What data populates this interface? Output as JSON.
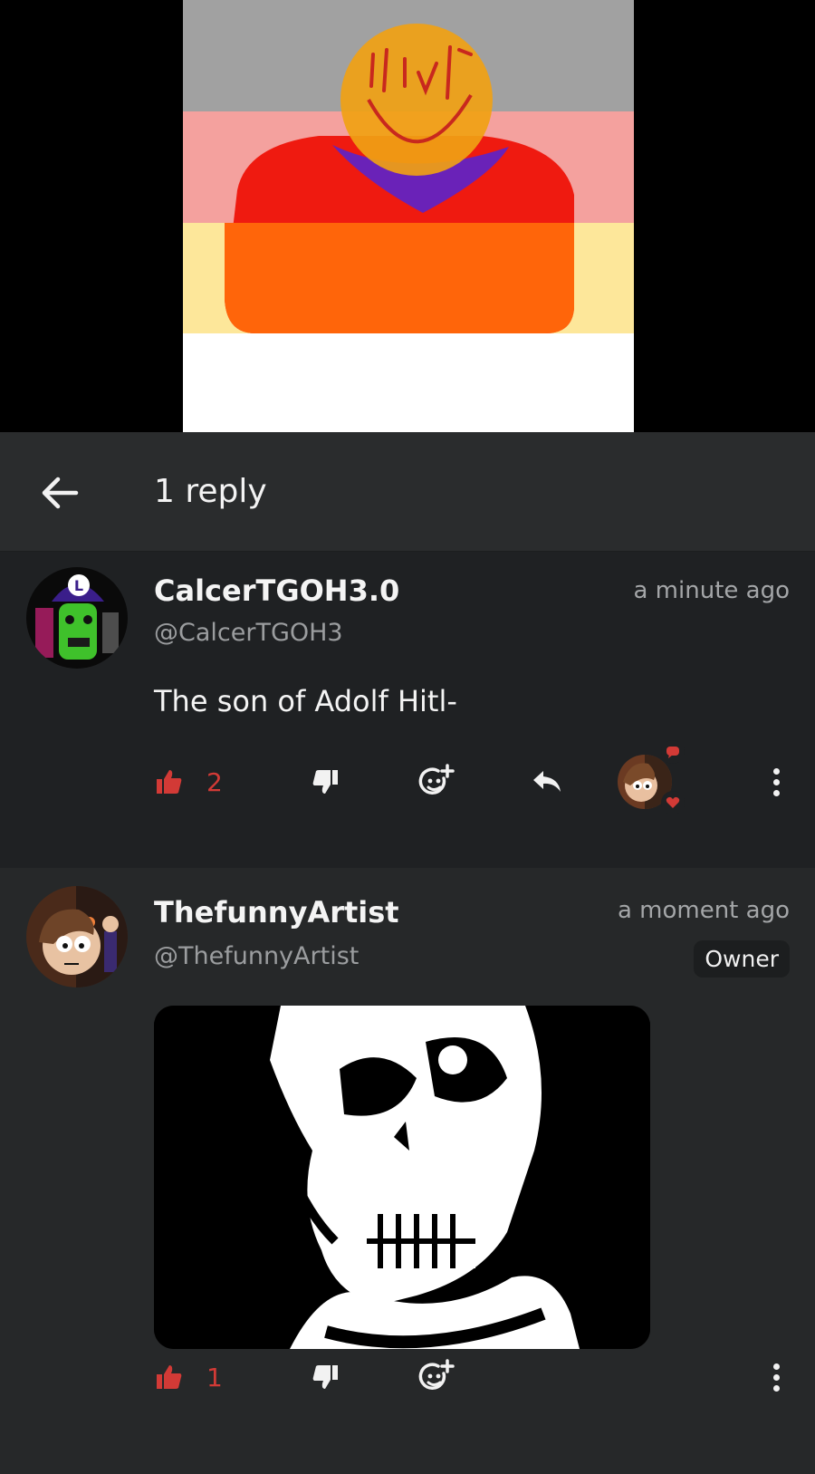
{
  "header": {
    "title": "1 reply"
  },
  "parent_comment": {
    "username": "CalcerTGOH3.0",
    "handle": "@CalcerTGOH3",
    "timestamp": "a minute ago",
    "text": "The son of Adolf Hitl-",
    "like_count": "2"
  },
  "reply_comment": {
    "username": "ThefunnyArtist",
    "handle": "@ThefunnyArtist",
    "timestamp": "a moment ago",
    "badge": "Owner",
    "like_count": "1"
  },
  "icons": {
    "back": "arrow-left-icon",
    "like": "thumbs-up-icon",
    "dislike": "thumbs-down-icon",
    "react": "add-emoji-icon",
    "reply": "reply-arrow-icon",
    "more": "more-vertical-icon"
  },
  "colors": {
    "accent": "#d23a36",
    "background": "#262829",
    "header": "#2a2c2d",
    "parent_bg": "#1f2123"
  }
}
